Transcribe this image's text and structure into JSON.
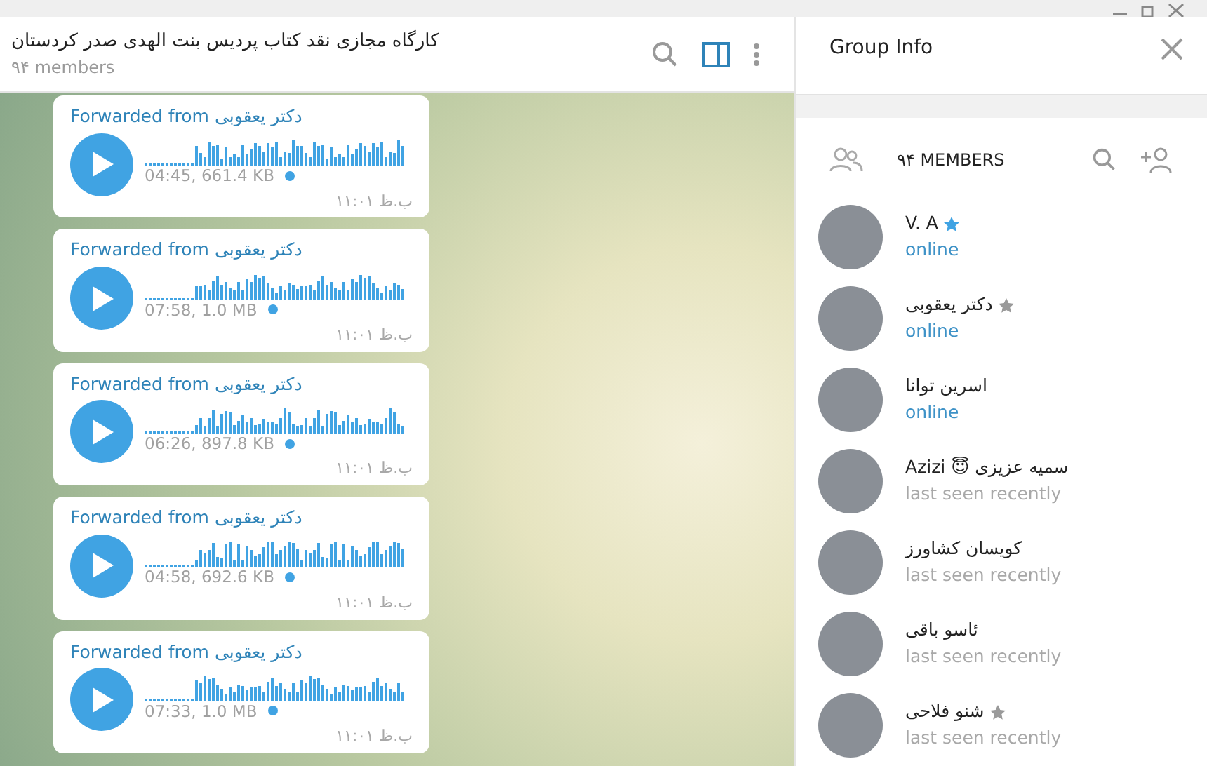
{
  "chat": {
    "title": "کارگاه مجازی نقد کتاب پردیس بنت الهدی صدر کردستان",
    "subtitle": "۹۴ members",
    "messages": [
      {
        "forwarded": "Forwarded from دکتر یعقوبی",
        "meta": "04:45, 661.4 KB",
        "unplayed": true,
        "time": "ب.ظ ۱۱:۰۱"
      },
      {
        "forwarded": "Forwarded from دکتر یعقوبی",
        "meta": "07:58, 1.0 MB",
        "unplayed": true,
        "time": "ب.ظ ۱۱:۰۱"
      },
      {
        "forwarded": "Forwarded from دکتر یعقوبی",
        "meta": "06:26, 897.8 KB",
        "unplayed": true,
        "time": "ب.ظ ۱۱:۰۱"
      },
      {
        "forwarded": "Forwarded from دکتر یعقوبی",
        "meta": "04:58, 692.6 KB",
        "unplayed": true,
        "time": "ب.ظ ۱۱:۰۱"
      },
      {
        "forwarded": "Forwarded from دکتر یعقوبی",
        "meta": "07:33, 1.0 MB",
        "unplayed": true,
        "time": "ب.ظ ۱۱:۰۱"
      }
    ]
  },
  "group_info": {
    "title": "Group Info",
    "members_count": "۹۴ MEMBERS",
    "members": [
      {
        "name": "V. A",
        "color": "#40a3e3",
        "status": "online",
        "online": true
      },
      {
        "name": "دکتر یعقوبی",
        "color": "#9a9a9a",
        "status": "online",
        "online": true
      },
      {
        "name": "اسرین توانا",
        "status": "online",
        "online": true
      },
      {
        "name": "Azizi 😇 سمیه عزیزی",
        "status": "last seen recently",
        "online": false
      },
      {
        "name": "کویسان کشاورز",
        "status": "last seen recently",
        "online": false
      },
      {
        "name": "ئاسو باقی",
        "status": "last seen recently",
        "online": false
      },
      {
        "name": "شنو فلاحی",
        "color": "#9a9a9a",
        "status": "last seen recently",
        "online": false
      }
    ]
  }
}
